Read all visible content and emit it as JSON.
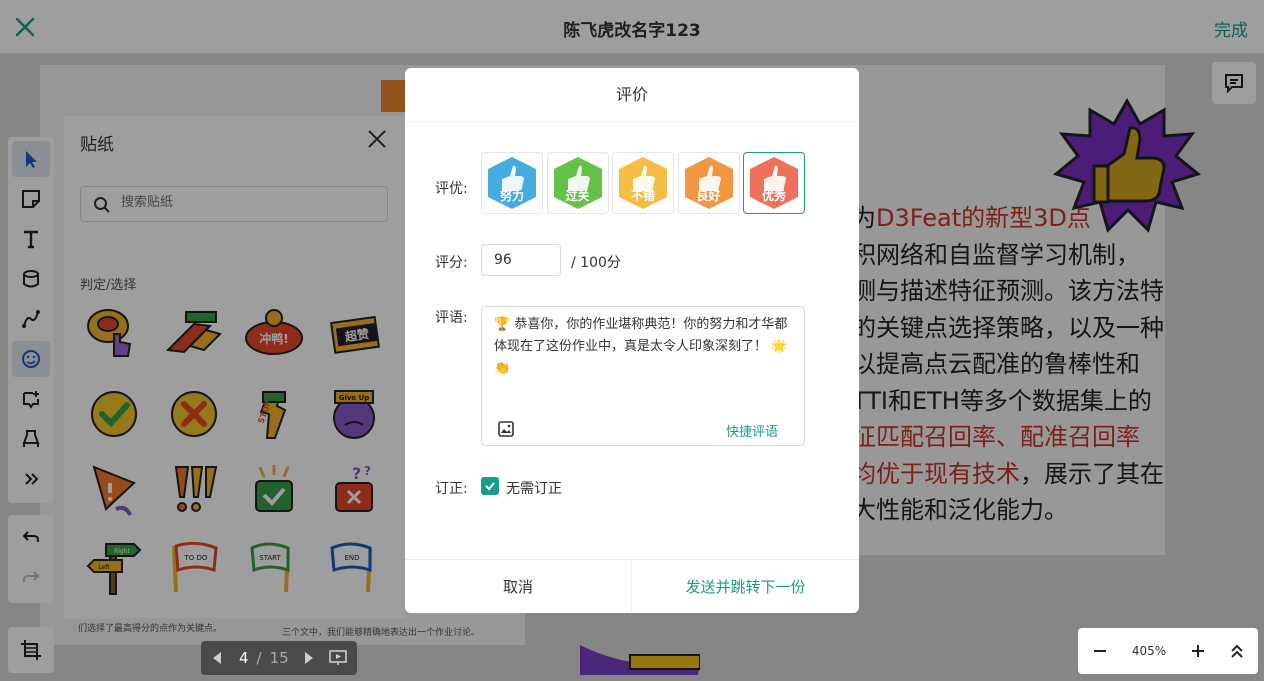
{
  "header": {
    "title": "陈飞虎改名字123",
    "done_label": "完成"
  },
  "sticker_panel": {
    "title": "贴纸",
    "search_placeholder": "搜索贴纸",
    "category": "判定/选择",
    "sticker_labels": [
      "超赞",
      "冲鸭!",
      "Give Up",
      "STOP",
      "Right",
      "Left",
      "TO DO",
      "START",
      "END"
    ]
  },
  "doc": {
    "lines": [
      {
        "parts": [
          {
            "t": "为",
            "red": false
          },
          {
            "t": "D3Feat的新型3D点",
            "red": true
          }
        ]
      },
      {
        "parts": [
          {
            "t": "积网络和自监督学习机制，",
            "red": false
          }
        ]
      },
      {
        "parts": [
          {
            "t": "测与描述特征预测。该方法特",
            "red": false
          }
        ]
      },
      {
        "parts": [
          {
            "t": "的关键点选择策略，以及一种",
            "red": false
          }
        ]
      },
      {
        "parts": [
          {
            "t": "  以提高点云配准的鲁棒性和",
            "red": false
          }
        ]
      },
      {
        "parts": [
          {
            "t": "TTI和ETH等多个数据集上的",
            "red": false
          }
        ]
      },
      {
        "parts": [
          {
            "t": "征匹配召回率、配准召回率",
            "red": true
          }
        ]
      },
      {
        "parts": [
          {
            "t": "均优于现有技术",
            "red": true
          },
          {
            "t": "，展示了其在",
            "red": false
          }
        ]
      },
      {
        "parts": [
          {
            "t": "大性能和泛化能力。",
            "red": false
          }
        ]
      }
    ],
    "small_left": "们选择了最高得分的点作为关键点。",
    "small_mid": "三个文中，我们能够精确地表达出一个作业讨论。"
  },
  "page_nav": {
    "current": "4",
    "separator": "/",
    "total": "15"
  },
  "zoom": {
    "level": "405%"
  },
  "modal": {
    "title": "评价",
    "grade_label": "评优:",
    "grades": [
      {
        "label": "努力",
        "color": "#3ba8e0"
      },
      {
        "label": "过关",
        "color": "#5cbf3c"
      },
      {
        "label": "不错",
        "color": "#f5b83a"
      },
      {
        "label": "良好",
        "color": "#f0913a"
      },
      {
        "label": "优秀",
        "color": "#ec6a55"
      }
    ],
    "selected_grade": "优秀",
    "score_label": "评分:",
    "score_value": "96",
    "score_total": "/ 100分",
    "comment_label": "评语:",
    "comment_text": "🏆 恭喜你，你的作业堪称典范！你的努力和才华都体现在了这份作业中，真是太令人印象深刻了！ 🌟 👏",
    "quick_comment": "快捷评语",
    "correction_label": "订正:",
    "no_correction_label": "无需订正",
    "no_correction_checked": true,
    "cancel_label": "取消",
    "send_label": "发送并跳转下一份"
  }
}
